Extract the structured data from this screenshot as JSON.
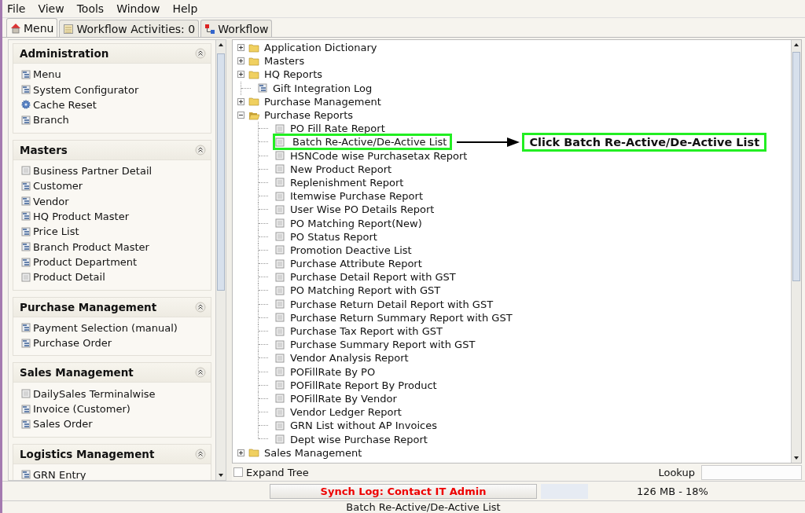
{
  "menu_bar": [
    "File",
    "View",
    "Tools",
    "Window",
    "Help"
  ],
  "tabs": [
    {
      "label": "Menu",
      "selected": true
    },
    {
      "label": "Workflow Activities: 0",
      "selected": false
    },
    {
      "label": "Workflow",
      "selected": false
    }
  ],
  "sidebar": {
    "sections": [
      {
        "title": "Administration",
        "items": [
          {
            "label": "Menu",
            "kind": "window"
          },
          {
            "label": "System Configurator",
            "kind": "window"
          },
          {
            "label": "Cache Reset",
            "kind": "process"
          },
          {
            "label": "Branch",
            "kind": "window"
          }
        ]
      },
      {
        "title": "Masters",
        "items": [
          {
            "label": "Business Partner Detail",
            "kind": "report"
          },
          {
            "label": "Customer",
            "kind": "window"
          },
          {
            "label": "Vendor",
            "kind": "window"
          },
          {
            "label": "HQ Product Master",
            "kind": "window"
          },
          {
            "label": "Price List",
            "kind": "window"
          },
          {
            "label": "Branch Product Master",
            "kind": "window"
          },
          {
            "label": "Product Department",
            "kind": "window"
          },
          {
            "label": "Product Detail",
            "kind": "report"
          }
        ]
      },
      {
        "title": "Purchase Management",
        "items": [
          {
            "label": "Payment Selection (manual)",
            "kind": "window"
          },
          {
            "label": "Purchase Order",
            "kind": "window"
          }
        ]
      },
      {
        "title": "Sales Management",
        "items": [
          {
            "label": "DailySales Terminalwise",
            "kind": "report"
          },
          {
            "label": "Invoice (Customer)",
            "kind": "window"
          },
          {
            "label": "Sales Order",
            "kind": "window"
          }
        ]
      },
      {
        "title": "Logistics Management",
        "items": [
          {
            "label": "GRN Entry",
            "kind": "window"
          }
        ]
      }
    ]
  },
  "tree": [
    {
      "label": "Application Dictionary",
      "kind": "folder",
      "expanded": false
    },
    {
      "label": "Masters",
      "kind": "folder",
      "expanded": false
    },
    {
      "label": "HQ Reports",
      "kind": "folder",
      "expanded": false
    },
    {
      "label": "Gift Integration Log",
      "kind": "window"
    },
    {
      "label": "Purchase Management",
      "kind": "folder",
      "expanded": false
    },
    {
      "label": "Purchase Reports",
      "kind": "folder",
      "expanded": true,
      "children": [
        {
          "label": "PO Fill Rate Report",
          "kind": "report"
        },
        {
          "label": "Batch Re-Active/De-Active List",
          "kind": "report",
          "highlighted": true
        },
        {
          "label": "HSNCode wise Purchasetax Report",
          "kind": "report"
        },
        {
          "label": "New Product Report",
          "kind": "report"
        },
        {
          "label": "Replenishment Report",
          "kind": "report"
        },
        {
          "label": "Itemwise Purchase Report",
          "kind": "report"
        },
        {
          "label": "User Wise PO Details Report",
          "kind": "report"
        },
        {
          "label": "PO Matching Report(New)",
          "kind": "report"
        },
        {
          "label": "PO Status Report",
          "kind": "report"
        },
        {
          "label": "Promotion Deactive List",
          "kind": "report"
        },
        {
          "label": "Purchase Attribute Report",
          "kind": "report"
        },
        {
          "label": "Purchase Detail Report with GST",
          "kind": "report"
        },
        {
          "label": "PO Matching Report with GST",
          "kind": "report"
        },
        {
          "label": "Purchase Return Detail Report with GST",
          "kind": "report"
        },
        {
          "label": "Purchase Return Summary Report with GST",
          "kind": "report"
        },
        {
          "label": "Purchase Tax Report with GST",
          "kind": "report"
        },
        {
          "label": "Purchase Summary Report with GST",
          "kind": "report"
        },
        {
          "label": "Vendor Analysis Report",
          "kind": "report"
        },
        {
          "label": "POFillRate By PO",
          "kind": "report"
        },
        {
          "label": "POFillRate Report By Product",
          "kind": "report"
        },
        {
          "label": "POFillRate By Vendor",
          "kind": "report"
        },
        {
          "label": "Vendor Ledger Report",
          "kind": "report"
        },
        {
          "label": "GRN List without AP Invoices",
          "kind": "report"
        },
        {
          "label": "Dept wise Purchase Report",
          "kind": "report"
        }
      ]
    },
    {
      "label": "Sales Management",
      "kind": "folder",
      "expanded": false
    }
  ],
  "annotation": {
    "text": "Click Batch Re-Active/De-Active List"
  },
  "expand_tree": {
    "label": "Expand Tree",
    "checked": false
  },
  "lookup": {
    "label": "Lookup"
  },
  "status": {
    "sync_button": "Synch Log: Contact IT Admin",
    "memory": "126 MB - 18%",
    "message": "Batch Re-Active/De-Active List"
  }
}
